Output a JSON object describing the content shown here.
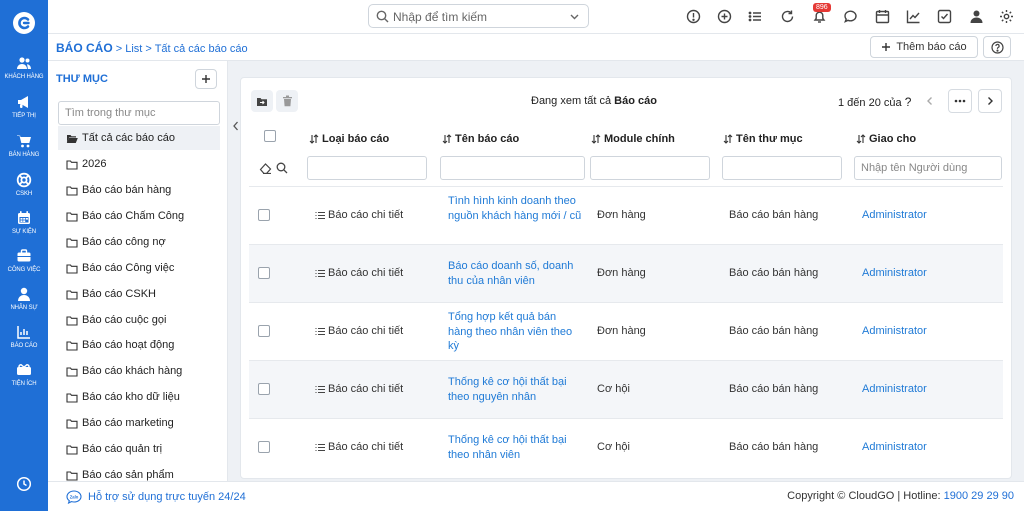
{
  "sidebar": {
    "items": [
      {
        "label": "KHÁCH HÀNG",
        "icon": "users-icon"
      },
      {
        "label": "TIẾP THỊ",
        "icon": "megaphone-icon"
      },
      {
        "label": "BÁN HÀNG",
        "icon": "cart-icon"
      },
      {
        "label": "CSKH",
        "icon": "lifebuoy-icon"
      },
      {
        "label": "SỰ KIỆN",
        "icon": "calendar-icon"
      },
      {
        "label": "CÔNG VIỆC",
        "icon": "briefcase-icon"
      },
      {
        "label": "NHÂN SỰ",
        "icon": "person-icon"
      },
      {
        "label": "BÁO CÁO",
        "icon": "report-icon"
      },
      {
        "label": "TIỆN ÍCH",
        "icon": "utilities-icon"
      }
    ]
  },
  "topbar": {
    "search_placeholder": "Nhập để tìm kiếm",
    "notification_count": "896"
  },
  "breadcrumb": {
    "root": "BÁO CÁO",
    "sep1": " > ",
    "level1": "List",
    "sep2": " > ",
    "level2": "Tất cả các báo cáo"
  },
  "actions": {
    "add_report": "Thêm báo cáo"
  },
  "folders": {
    "title": "THƯ MỤC",
    "search_placeholder": "Tìm trong thư mục",
    "items": [
      "Tất cả các báo cáo",
      "2026",
      "Báo cáo bán hàng",
      "Báo cáo Chấm Công",
      "Báo cáo công nợ",
      "Báo cáo Công việc",
      "Báo cáo CSKH",
      "Báo cáo cuộc gọi",
      "Báo cáo hoạt động",
      "Báo cáo khách hàng",
      "Báo cáo kho dữ liệu",
      "Báo cáo marketing",
      "Báo cáo quản trị",
      "Báo cáo sản phẩm"
    ]
  },
  "list": {
    "viewing_prefix": "Đang xem tất cả ",
    "viewing_bold": "Báo cáo",
    "page_info": "1 đến 20 của",
    "page_info_q": "?",
    "columns": [
      "Loại báo cáo",
      "Tên báo cáo",
      "Module chính",
      "Tên thư mục",
      "Giao cho"
    ],
    "filter_assigned_placeholder": "Nhập tên Người dùng",
    "rows": [
      {
        "type": "Báo cáo chi tiết",
        "name": "Tình hình kinh doanh theo nguồn khách hàng mới / cũ",
        "module": "Đơn hàng",
        "folder": "Báo cáo bán hàng",
        "assigned": "Administrator"
      },
      {
        "type": "Báo cáo chi tiết",
        "name": "Báo cáo doanh số, doanh thu của nhân viên",
        "module": "Đơn hàng",
        "folder": "Báo cáo bán hàng",
        "assigned": "Administrator"
      },
      {
        "type": "Báo cáo chi tiết",
        "name": "Tổng hợp kết quả bán hàng theo nhân viên theo kỳ",
        "module": "Đơn hàng",
        "folder": "Báo cáo bán hàng",
        "assigned": "Administrator"
      },
      {
        "type": "Báo cáo chi tiết",
        "name": "Thống kê cơ hội thất bại theo nguyên nhân",
        "module": "Cơ hội",
        "folder": "Báo cáo bán hàng",
        "assigned": "Administrator"
      },
      {
        "type": "Báo cáo chi tiết",
        "name": "Thống kê cơ hội thất bại theo nhân viên",
        "module": "Cơ hội",
        "folder": "Báo cáo bán hàng",
        "assigned": "Administrator"
      }
    ]
  },
  "footer": {
    "support": "Hỗ trợ sử dụng trực tuyến 24/24",
    "copyright": "Copyright © CloudGO | Hotline: ",
    "hotline": "1900 29 29 90"
  },
  "colors": {
    "brand": "#1f6fd6",
    "link": "#1f7ad6",
    "badge": "#e53935"
  }
}
